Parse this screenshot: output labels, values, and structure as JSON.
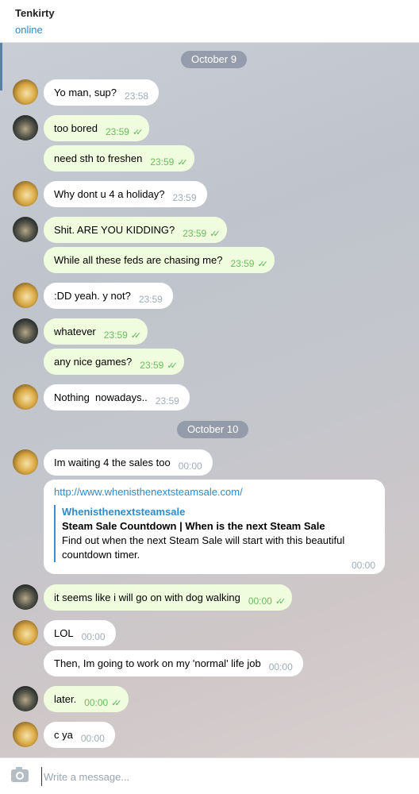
{
  "header": {
    "contact_name": "Tenkirty",
    "status": "online"
  },
  "dates": [
    "October 9",
    "October 10"
  ],
  "messages": [
    {
      "text": "Yo man, sup?",
      "time": "23:58"
    },
    {
      "text": "too bored",
      "time": "23:59"
    },
    {
      "text": "need sth to freshen",
      "time": "23:59"
    },
    {
      "text": "Why dont u 4 a holiday?",
      "time": "23:59"
    },
    {
      "text": "Shit. ARE YOU KIDDING?",
      "time": "23:59"
    },
    {
      "text": "While all these feds are chasing me?",
      "time": "23:59"
    },
    {
      "text": ":DD yeah. y not?",
      "time": "23:59"
    },
    {
      "text": "whatever",
      "time": "23:59"
    },
    {
      "text": "any nice games?",
      "time": "23:59"
    },
    {
      "text": "Nothing  nowadays..",
      "time": "23:59"
    },
    {
      "text": "Im waiting 4 the sales too",
      "time": "00:00"
    },
    {
      "text": "it seems like i will go on with dog walking",
      "time": "00:00"
    },
    {
      "text": "LOL",
      "time": "00:00"
    },
    {
      "text": "Then, Im going to work on my 'normal' life job",
      "time": "00:00"
    },
    {
      "text": "later.",
      "time": "00:00"
    },
    {
      "text": "c ya",
      "time": "00:00"
    }
  ],
  "link_message": {
    "url": "http://www.whenisthenextsteamsale.com/",
    "site_name": "Whenisthenextsteamsale",
    "title": "Steam Sale Countdown | When is the next Steam Sale",
    "description": "Find out when the next Steam Sale will start with this beautiful countdown timer.",
    "time": "00:00"
  },
  "composer": {
    "placeholder": "Write a message..."
  },
  "icons": {
    "attach": "camera-icon",
    "read_receipt": "double-check-icon"
  },
  "colors": {
    "outgoing_bubble": "#effdde",
    "incoming_bubble": "#ffffff",
    "link": "#2f8ac9",
    "check": "#5cb55a"
  }
}
